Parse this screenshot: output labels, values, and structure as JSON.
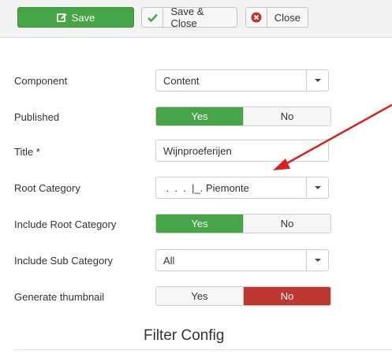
{
  "toolbar": {
    "save_label": "Save",
    "save_close_label": "Save & Close",
    "close_label": "Close"
  },
  "form": {
    "component": {
      "label": "Component",
      "value": "Content"
    },
    "published": {
      "label": "Published",
      "yes": "Yes",
      "no": "No",
      "selected": "Yes"
    },
    "title": {
      "label": "Title  *",
      "value": "Wijnproeferijen"
    },
    "root_category": {
      "label": "Root Category",
      "value": " .  .  .  |_. Piemonte"
    },
    "include_root_category": {
      "label": "Include Root Category",
      "yes": "Yes",
      "no": "No",
      "selected": "Yes"
    },
    "include_sub_category": {
      "label": "Include Sub Category",
      "value": "All"
    },
    "generate_thumbnail": {
      "label": "Generate thumbnail",
      "yes": "Yes",
      "no": "No",
      "selected": "No"
    }
  },
  "section": {
    "title": "Filter Config"
  },
  "colors": {
    "accent_green": "#46a546",
    "accent_red": "#bd362f",
    "annotation_arrow": "#d9221c"
  },
  "icons": {
    "save": "edit-icon",
    "save_close": "check-icon",
    "close": "close-circle-icon",
    "dropdown": "caret-down-icon"
  }
}
